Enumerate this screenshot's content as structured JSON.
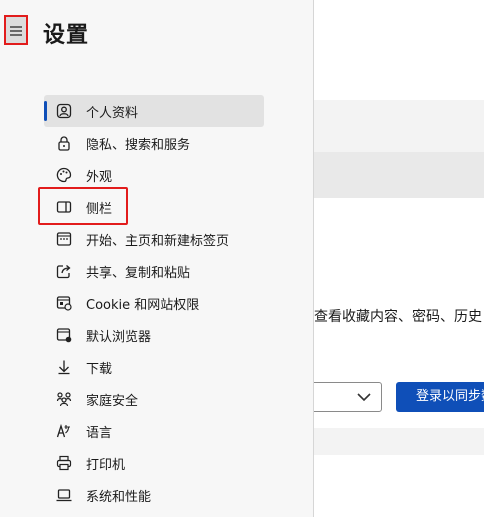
{
  "header": {
    "title": "设置",
    "menu_icon": "hamburger-icon"
  },
  "nav": {
    "items": [
      {
        "label": "个人资料",
        "icon": "profile-icon",
        "active": true
      },
      {
        "label": "隐私、搜索和服务",
        "icon": "lock-icon"
      },
      {
        "label": "外观",
        "icon": "palette-icon"
      },
      {
        "label": "侧栏",
        "icon": "sidebar-icon"
      },
      {
        "label": "开始、主页和新建标签页",
        "icon": "home-grid-icon"
      },
      {
        "label": "共享、复制和粘贴",
        "icon": "share-icon"
      },
      {
        "label": "Cookie 和网站权限",
        "icon": "site-permissions-icon"
      },
      {
        "label": "默认浏览器",
        "icon": "browser-icon"
      },
      {
        "label": "下载",
        "icon": "download-icon"
      },
      {
        "label": "家庭安全",
        "icon": "family-icon"
      },
      {
        "label": "语言",
        "icon": "language-icon"
      },
      {
        "label": "打印机",
        "icon": "printer-icon"
      },
      {
        "label": "系统和性能",
        "icon": "laptop-icon"
      }
    ]
  },
  "background": {
    "sync_text": "查看收藏内容、密码、历史",
    "sync_button": "登录以同步数"
  },
  "colors": {
    "accent": "#0f4fb8",
    "highlight_red": "#e21c1c"
  }
}
